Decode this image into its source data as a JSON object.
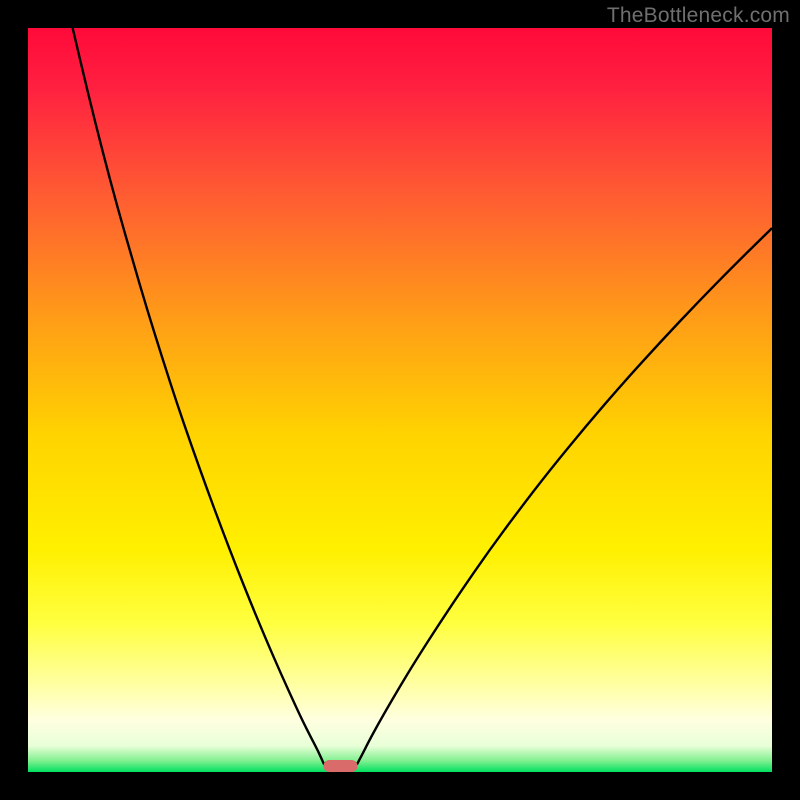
{
  "watermark": "TheBottleneck.com",
  "chart_data": {
    "type": "line",
    "title": "",
    "xlabel": "",
    "ylabel": "",
    "xlim": [
      0,
      100
    ],
    "ylim": [
      0,
      100
    ],
    "background_gradient": {
      "stops": [
        {
          "offset": 0.0,
          "color": "#ff0a3a"
        },
        {
          "offset": 0.08,
          "color": "#ff2040"
        },
        {
          "offset": 0.22,
          "color": "#ff5a33"
        },
        {
          "offset": 0.4,
          "color": "#ffa016"
        },
        {
          "offset": 0.55,
          "color": "#ffd400"
        },
        {
          "offset": 0.7,
          "color": "#fff000"
        },
        {
          "offset": 0.8,
          "color": "#ffff40"
        },
        {
          "offset": 0.88,
          "color": "#ffffa0"
        },
        {
          "offset": 0.93,
          "color": "#ffffe0"
        },
        {
          "offset": 0.965,
          "color": "#e8ffd8"
        },
        {
          "offset": 0.985,
          "color": "#80f090"
        },
        {
          "offset": 1.0,
          "color": "#00e060"
        }
      ]
    },
    "series": [
      {
        "name": "curve-left",
        "x": [
          6.0,
          8.0,
          10.0,
          12.0,
          14.0,
          16.0,
          18.0,
          20.0,
          22.0,
          24.0,
          26.0,
          28.0,
          30.0,
          32.0,
          34.0,
          36.0,
          37.0,
          38.0,
          39.0,
          39.8
        ],
        "values": [
          100,
          91.5,
          83.5,
          76.0,
          69.0,
          62.2,
          55.8,
          49.6,
          43.8,
          38.2,
          32.8,
          27.6,
          22.6,
          17.8,
          13.2,
          8.8,
          6.7,
          4.7,
          2.8,
          1.0
        ]
      },
      {
        "name": "curve-right",
        "x": [
          44.2,
          45.0,
          46.0,
          48.0,
          50.0,
          52.0,
          55.0,
          58.0,
          62.0,
          66.0,
          70.0,
          75.0,
          80.0,
          85.0,
          90.0,
          95.0,
          100.0
        ],
        "values": [
          1.0,
          2.5,
          4.5,
          8.1,
          11.5,
          14.8,
          19.5,
          24.0,
          29.8,
          35.2,
          40.4,
          46.5,
          52.3,
          57.8,
          63.1,
          68.2,
          73.1
        ]
      }
    ],
    "marker": {
      "name": "bottleneck-marker",
      "x_center": 42.0,
      "x_halfwidth": 2.3,
      "y": 0.8,
      "color": "#d96b6b"
    }
  }
}
